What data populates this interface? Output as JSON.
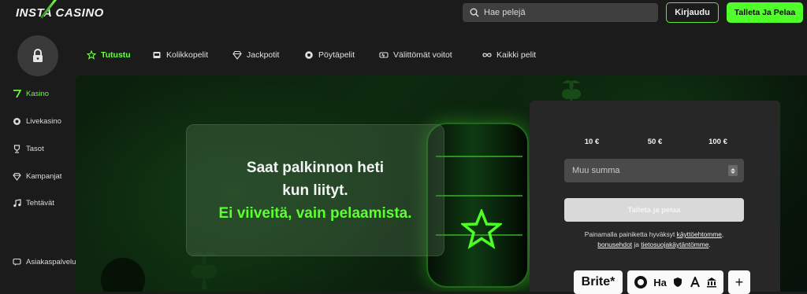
{
  "brand": {
    "logo_text": "INSTA CASINO"
  },
  "header": {
    "search_placeholder": "Hae pelejä",
    "login_label": "Kirjaudu",
    "deposit_label": "Talleta Ja Pelaa"
  },
  "sidebar": {
    "items": [
      {
        "label": "Kasino",
        "icon": "seven-icon",
        "active": true
      },
      {
        "label": "Livekasino",
        "icon": "chip-hand-icon"
      },
      {
        "label": "Tasot",
        "icon": "trophy-icon"
      },
      {
        "label": "Kampanjat",
        "icon": "diamond-icon"
      },
      {
        "label": "Tehtävät",
        "icon": "music-note-icon"
      },
      {
        "label": "Asiakaspalvelu",
        "icon": "chat-icon"
      }
    ]
  },
  "tabs": [
    {
      "label": "Tutustu",
      "icon": "star-icon",
      "active": true
    },
    {
      "label": "Kolikkopelit",
      "icon": "slot-icon"
    },
    {
      "label": "Jackpotit",
      "icon": "diamond-icon"
    },
    {
      "label": "Pöytäpelit",
      "icon": "chips-icon"
    },
    {
      "label": "Välittömät voitot",
      "icon": "instant-icon"
    },
    {
      "label": "Kaikki pelit",
      "icon": "infinity-icon"
    }
  ],
  "promo": {
    "line1": "Saat palkinnon heti",
    "line2": "kun liityt.",
    "line3": "Ei viiveitä, vain pelaamista."
  },
  "deposit_panel": {
    "amounts": [
      "10 €",
      "50 €",
      "100 €"
    ],
    "custom_placeholder": "Muu summa",
    "submit_label": "Talleta ja pelaa",
    "terms_prefix": "Painamalla painiketta hyväksyt",
    "terms_link1": "käyttöehtomme",
    "terms_link2": "bonusehdot",
    "terms_joiner": "ja",
    "terms_link3": "tietosuojakäytäntömme",
    "payment_logos": [
      "Brite*",
      "Ha",
      "+"
    ]
  },
  "colors": {
    "accent": "#4fff2a",
    "background": "#1b1b1b",
    "panel": "#272727"
  }
}
